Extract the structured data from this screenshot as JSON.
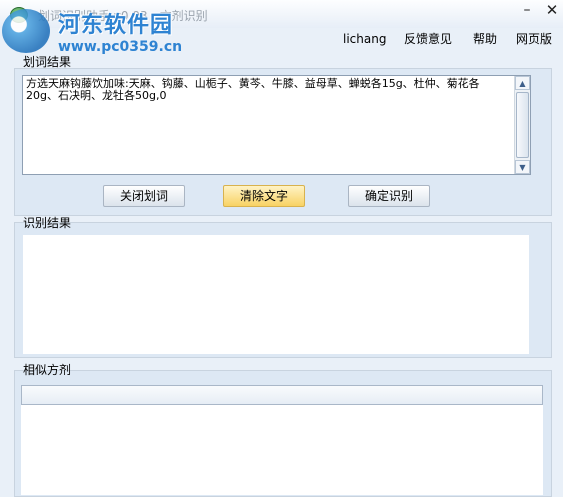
{
  "window": {
    "title": "划词识别助手 v0.93 - 方剂识别",
    "minimize_glyph": "–",
    "close_glyph": "✕"
  },
  "watermark": {
    "text": "河东软件园",
    "url": "www.pc0359.cn"
  },
  "menu": {
    "user": "lichang",
    "feedback": "反馈意见",
    "help": "帮助",
    "web": "网页版"
  },
  "sections": {
    "selection_label": "划词结果",
    "recognition_label": "识别结果",
    "similar_label": "相似方剂"
  },
  "selection_text": "方选天麻钩藤饮加味:天麻、钩藤、山栀子、黄芩、牛膝、益母草、蝉蜕各15g、杜仲、菊花各20g、石决明、龙牡各50g,0",
  "buttons": {
    "close_select": "关闭划词",
    "clear_text": "清除文字",
    "confirm": "确定识别"
  },
  "icons": {
    "app": "app-logo-icon",
    "scroll_up": "arrow-up-icon",
    "scroll_down": "arrow-down-icon"
  }
}
